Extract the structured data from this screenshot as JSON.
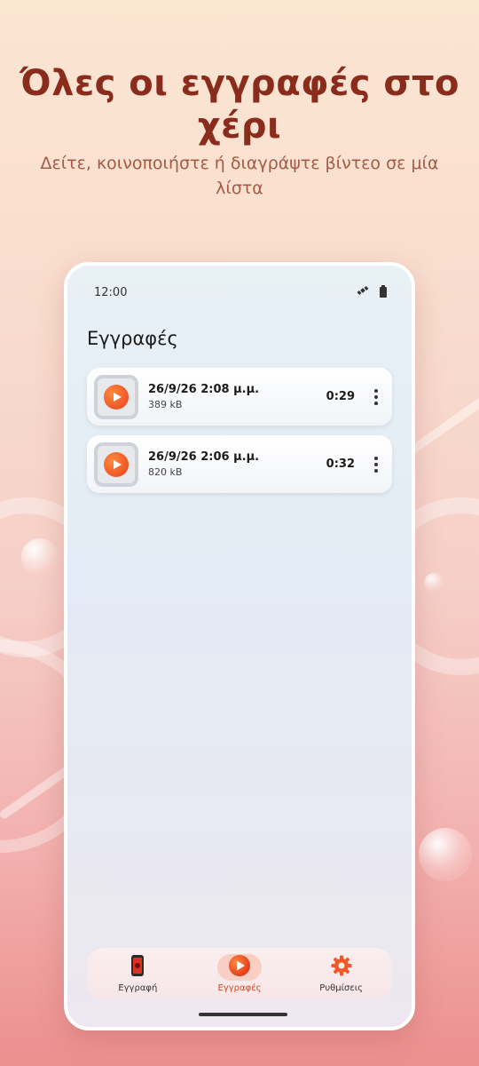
{
  "promo": {
    "headline": "Όλες οι εγγραφές στο χέρι",
    "subline": "Δείτε, κοινοποιήστε ή διαγράψτε βίντεο σε μία λίστα"
  },
  "statusbar": {
    "time": "12:00",
    "icons": [
      "satellite-icon",
      "battery-icon"
    ]
  },
  "screen": {
    "title": "Εγγραφές"
  },
  "recordings": [
    {
      "date": "26/9/26 2:08 μ.μ.",
      "size": "389 kB",
      "duration": "0:29"
    },
    {
      "date": "26/9/26 2:06 μ.μ.",
      "size": "820 kB",
      "duration": "0:32"
    }
  ],
  "nav": {
    "items": [
      {
        "label": "Εγγραφή",
        "icon": "phone-record-icon",
        "active": false
      },
      {
        "label": "Εγγραφές",
        "icon": "play-icon",
        "active": true
      },
      {
        "label": "Ρυθμίσεις",
        "icon": "gear-icon",
        "active": false
      }
    ]
  },
  "colors": {
    "accent": "#ea3e1c",
    "headline": "#8a2c1c",
    "active_nav": "#d2441f"
  }
}
